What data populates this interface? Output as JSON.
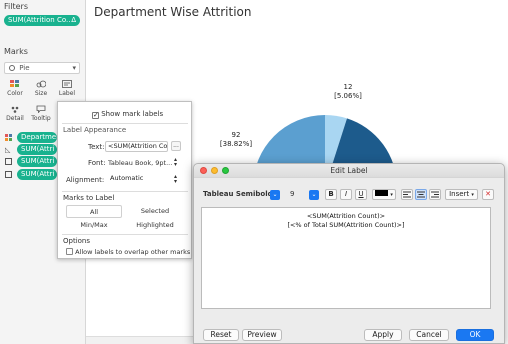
{
  "left_pane": {
    "filters_title": "Filters",
    "filter_pill": "SUM(Attrition Co..",
    "filter_pill_icon": "delta",
    "marks_title": "Marks",
    "mark_type": "Pie",
    "cards": [
      {
        "label": "Color",
        "icon": "color-swatch-icon"
      },
      {
        "label": "Size",
        "icon": "size-icon"
      },
      {
        "label": "Label",
        "icon": "label-icon"
      },
      {
        "label": "Detail",
        "icon": "detail-icon"
      },
      {
        "label": "Tooltip",
        "icon": "tooltip-icon"
      }
    ],
    "mark_pills": [
      "Departmen",
      "SUM(Attri",
      "SUM(Attri",
      "SUM(Attri"
    ]
  },
  "chart": {
    "title": "Department Wise Attrition",
    "label_top_value": "12",
    "label_top_pct": "[5.06%]",
    "label_left_value": "92",
    "label_left_pct": "[38.82%]",
    "colors": {
      "light": "#a9d6f2",
      "mid": "#5b9fd0",
      "dark": "#1d5b8c"
    }
  },
  "chart_data": {
    "type": "pie",
    "title": "Department Wise Attrition",
    "slices": [
      {
        "value": 12,
        "percent": 5.06
      },
      {
        "value": 92,
        "percent": 38.82
      }
    ]
  },
  "label_popover": {
    "show_mark_labels": "Show mark labels",
    "appearance_title": "Label Appearance",
    "text_label": "Text:",
    "text_value": "<SUM(Attrition Cou",
    "ellipsis": "...",
    "font_label": "Font:",
    "font_value": "Tableau Book, 9pt...",
    "alignment_label": "Alignment:",
    "alignment_value": "Automatic",
    "marks_to_label_title": "Marks to Label",
    "options_mtl": [
      "All",
      "Selected",
      "Min/Max",
      "Highlighted"
    ],
    "options_title": "Options",
    "overlap_label": "Allow labels to overlap other marks"
  },
  "edit_label": {
    "title": "Edit Label",
    "font": "Tableau Semibold",
    "size": "9",
    "bold": "B",
    "italic": "I",
    "underline": "U",
    "insert": "Insert",
    "line1": "<SUM(Attrition Count)>",
    "line2": "[<% of Total SUM(Attrition Count)>]",
    "reset": "Reset",
    "preview": "Preview",
    "apply": "Apply",
    "cancel": "Cancel",
    "ok": "OK"
  }
}
